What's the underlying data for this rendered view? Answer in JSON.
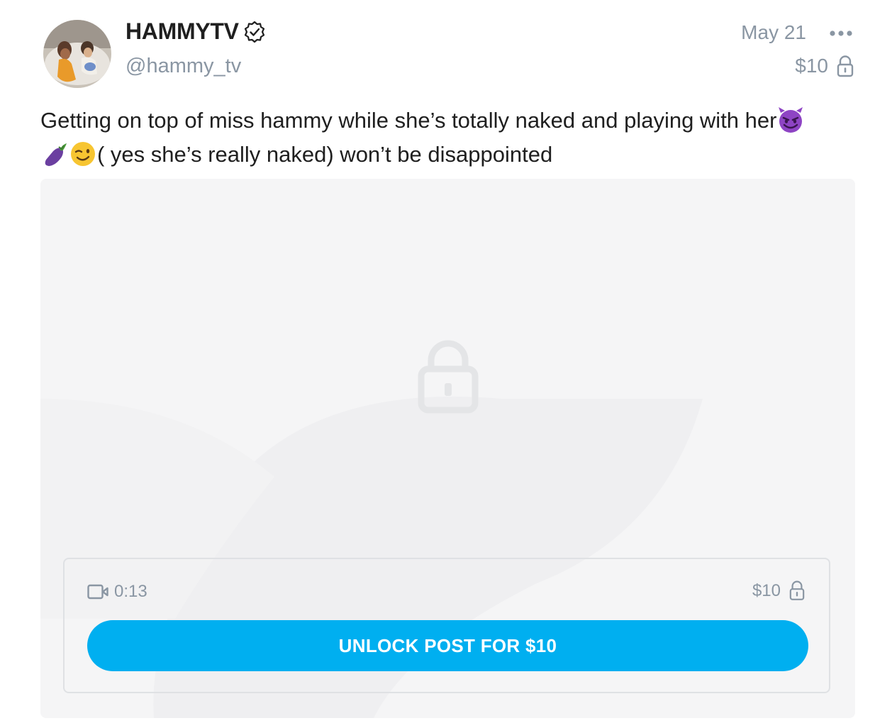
{
  "post": {
    "author": {
      "display_name": "HAMMYTV",
      "handle": "@hammy_tv",
      "verified": true,
      "avatar": "avatar-photo"
    },
    "date": "May 21",
    "price": "$10",
    "caption_line1": "Getting on top of miss hammy while she’s totally naked and playing with her",
    "caption_line2": "( yes she’s really naked) won’t be disappointed",
    "caption_emojis": [
      "smiling-imp-emoji",
      "eggplant-emoji",
      "winking-face-emoji"
    ],
    "icons": {
      "verified": "verified-badge-icon",
      "more": "more-options-icon",
      "lock": "lock-icon",
      "video": "video-camera-icon"
    }
  },
  "media": {
    "locked_icon": "lock-icon",
    "duration": "0:13",
    "price": "$10",
    "unlock_button_label": "UNLOCK POST FOR $10"
  },
  "colors": {
    "accent": "#00aff0",
    "muted_text": "#8a96a3",
    "media_bg": "#f5f5f6"
  }
}
